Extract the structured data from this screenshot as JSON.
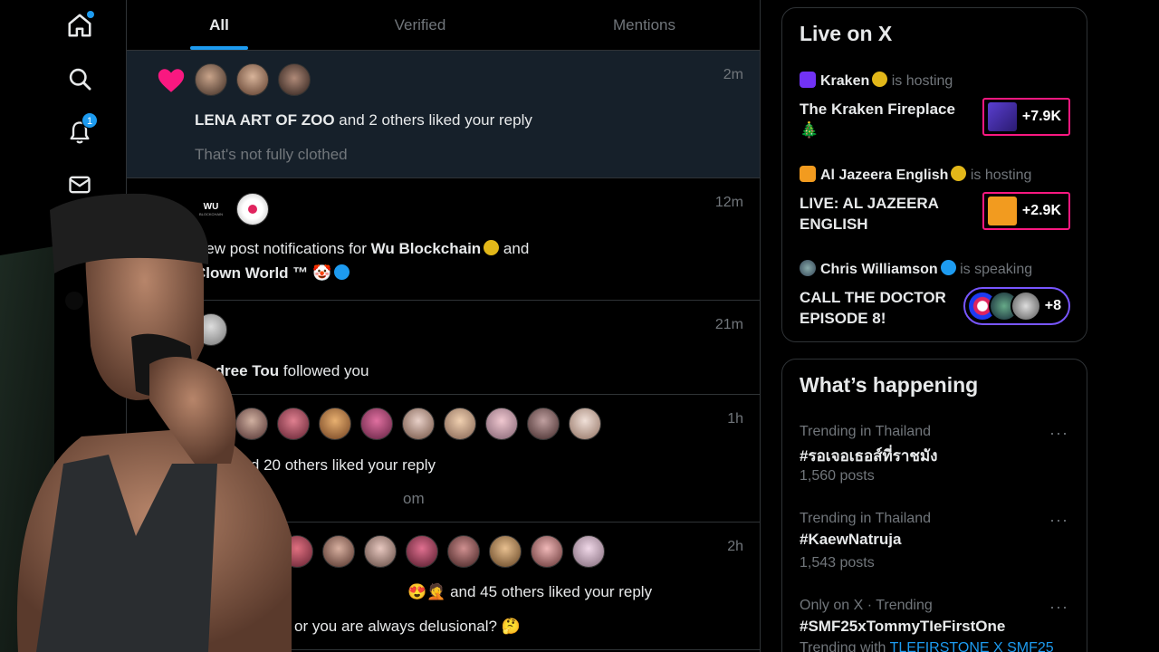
{
  "nav": {
    "items": [
      {
        "name": "home",
        "icon": "home-icon"
      },
      {
        "name": "explore",
        "icon": "search-icon"
      },
      {
        "name": "notifications",
        "icon": "bell-icon",
        "badge": "1"
      },
      {
        "name": "messages",
        "icon": "mail-icon"
      }
    ]
  },
  "tabs": [
    {
      "label": "All",
      "active": true
    },
    {
      "label": "Verified",
      "active": false
    },
    {
      "label": "Mentions",
      "active": false
    }
  ],
  "notifications": [
    {
      "time": "2m",
      "actor": "LENA ART OF ZOO",
      "rest": " and 2 others liked your reply",
      "sub": "That's not fully clothed"
    },
    {
      "time": "12m",
      "logo_text": "WU",
      "logo_sub": "BLOCKCHAIN",
      "line1_pre": "New post notifications for ",
      "line1_bold": "Wu Blockchain",
      "line1_post": " and",
      "line2_bold": "Clown World ™",
      "line2_emoji": "🤡"
    },
    {
      "time": "21m",
      "actor": "Andree Tou",
      "rest": " followed you"
    },
    {
      "time": "1h",
      "text": "and 20 others liked your reply",
      "sub": "om"
    },
    {
      "time": "2h",
      "emoji": "😍🤦",
      "text": " and 45 others liked your reply",
      "sub": "or you are always delusional? 🤔"
    }
  ],
  "live": {
    "title": "Live on X",
    "items": [
      {
        "host": "Kraken",
        "hosting": "is hosting",
        "title": "The Kraken Fireplace 🎄",
        "count": "+7.9K"
      },
      {
        "host": "Al Jazeera English",
        "hosting": "is hosting",
        "title": "LIVE: AL JAZEERA ENGLISH",
        "count": "+2.9K"
      },
      {
        "host": "Chris Williamson",
        "hosting": "is speaking",
        "title": "CALL THE DOCTOR EPISODE 8!",
        "count": "+8"
      }
    ]
  },
  "happening": {
    "title": "What’s happening",
    "trends": [
      {
        "meta": "Trending in Thailand",
        "name": "#รอเจอเธอส์ที่ราชมัง",
        "count": "1,560 posts"
      },
      {
        "meta": "Trending in Thailand",
        "name": "#KaewNatruja",
        "count": "1,543 posts"
      },
      {
        "meta": "Only on X · Trending",
        "name": "#SMF25xTommyTIeFirstOne",
        "count_prefix": "Trending with",
        "count_link": "TLEFIRSTONE X SMF25"
      }
    ],
    "more_label": "···"
  },
  "colors": {
    "accent": "#1d9bf0",
    "like": "#f91880",
    "live_border": "#f91880",
    "space_border": "#7856ff",
    "gold_check": "#e2b719"
  }
}
